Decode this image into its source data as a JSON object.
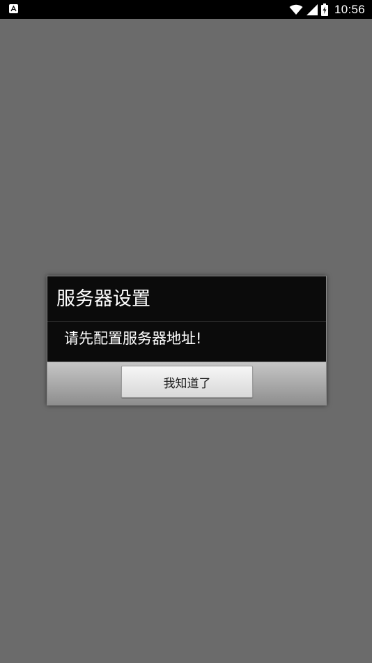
{
  "status_bar": {
    "left_icon": "a-notification-icon",
    "icons": [
      "wifi-icon",
      "signal-icon",
      "battery-charging-icon"
    ],
    "time": "10:56"
  },
  "dialog": {
    "title": "服务器设置",
    "message": "请先配置服务器地址!",
    "ok_label": "我知道了"
  },
  "colors": {
    "background": "#6b6b6b",
    "status_bar": "#000000",
    "dialog_body": "#0b0b0b",
    "button_face": "#e8e8e8"
  }
}
